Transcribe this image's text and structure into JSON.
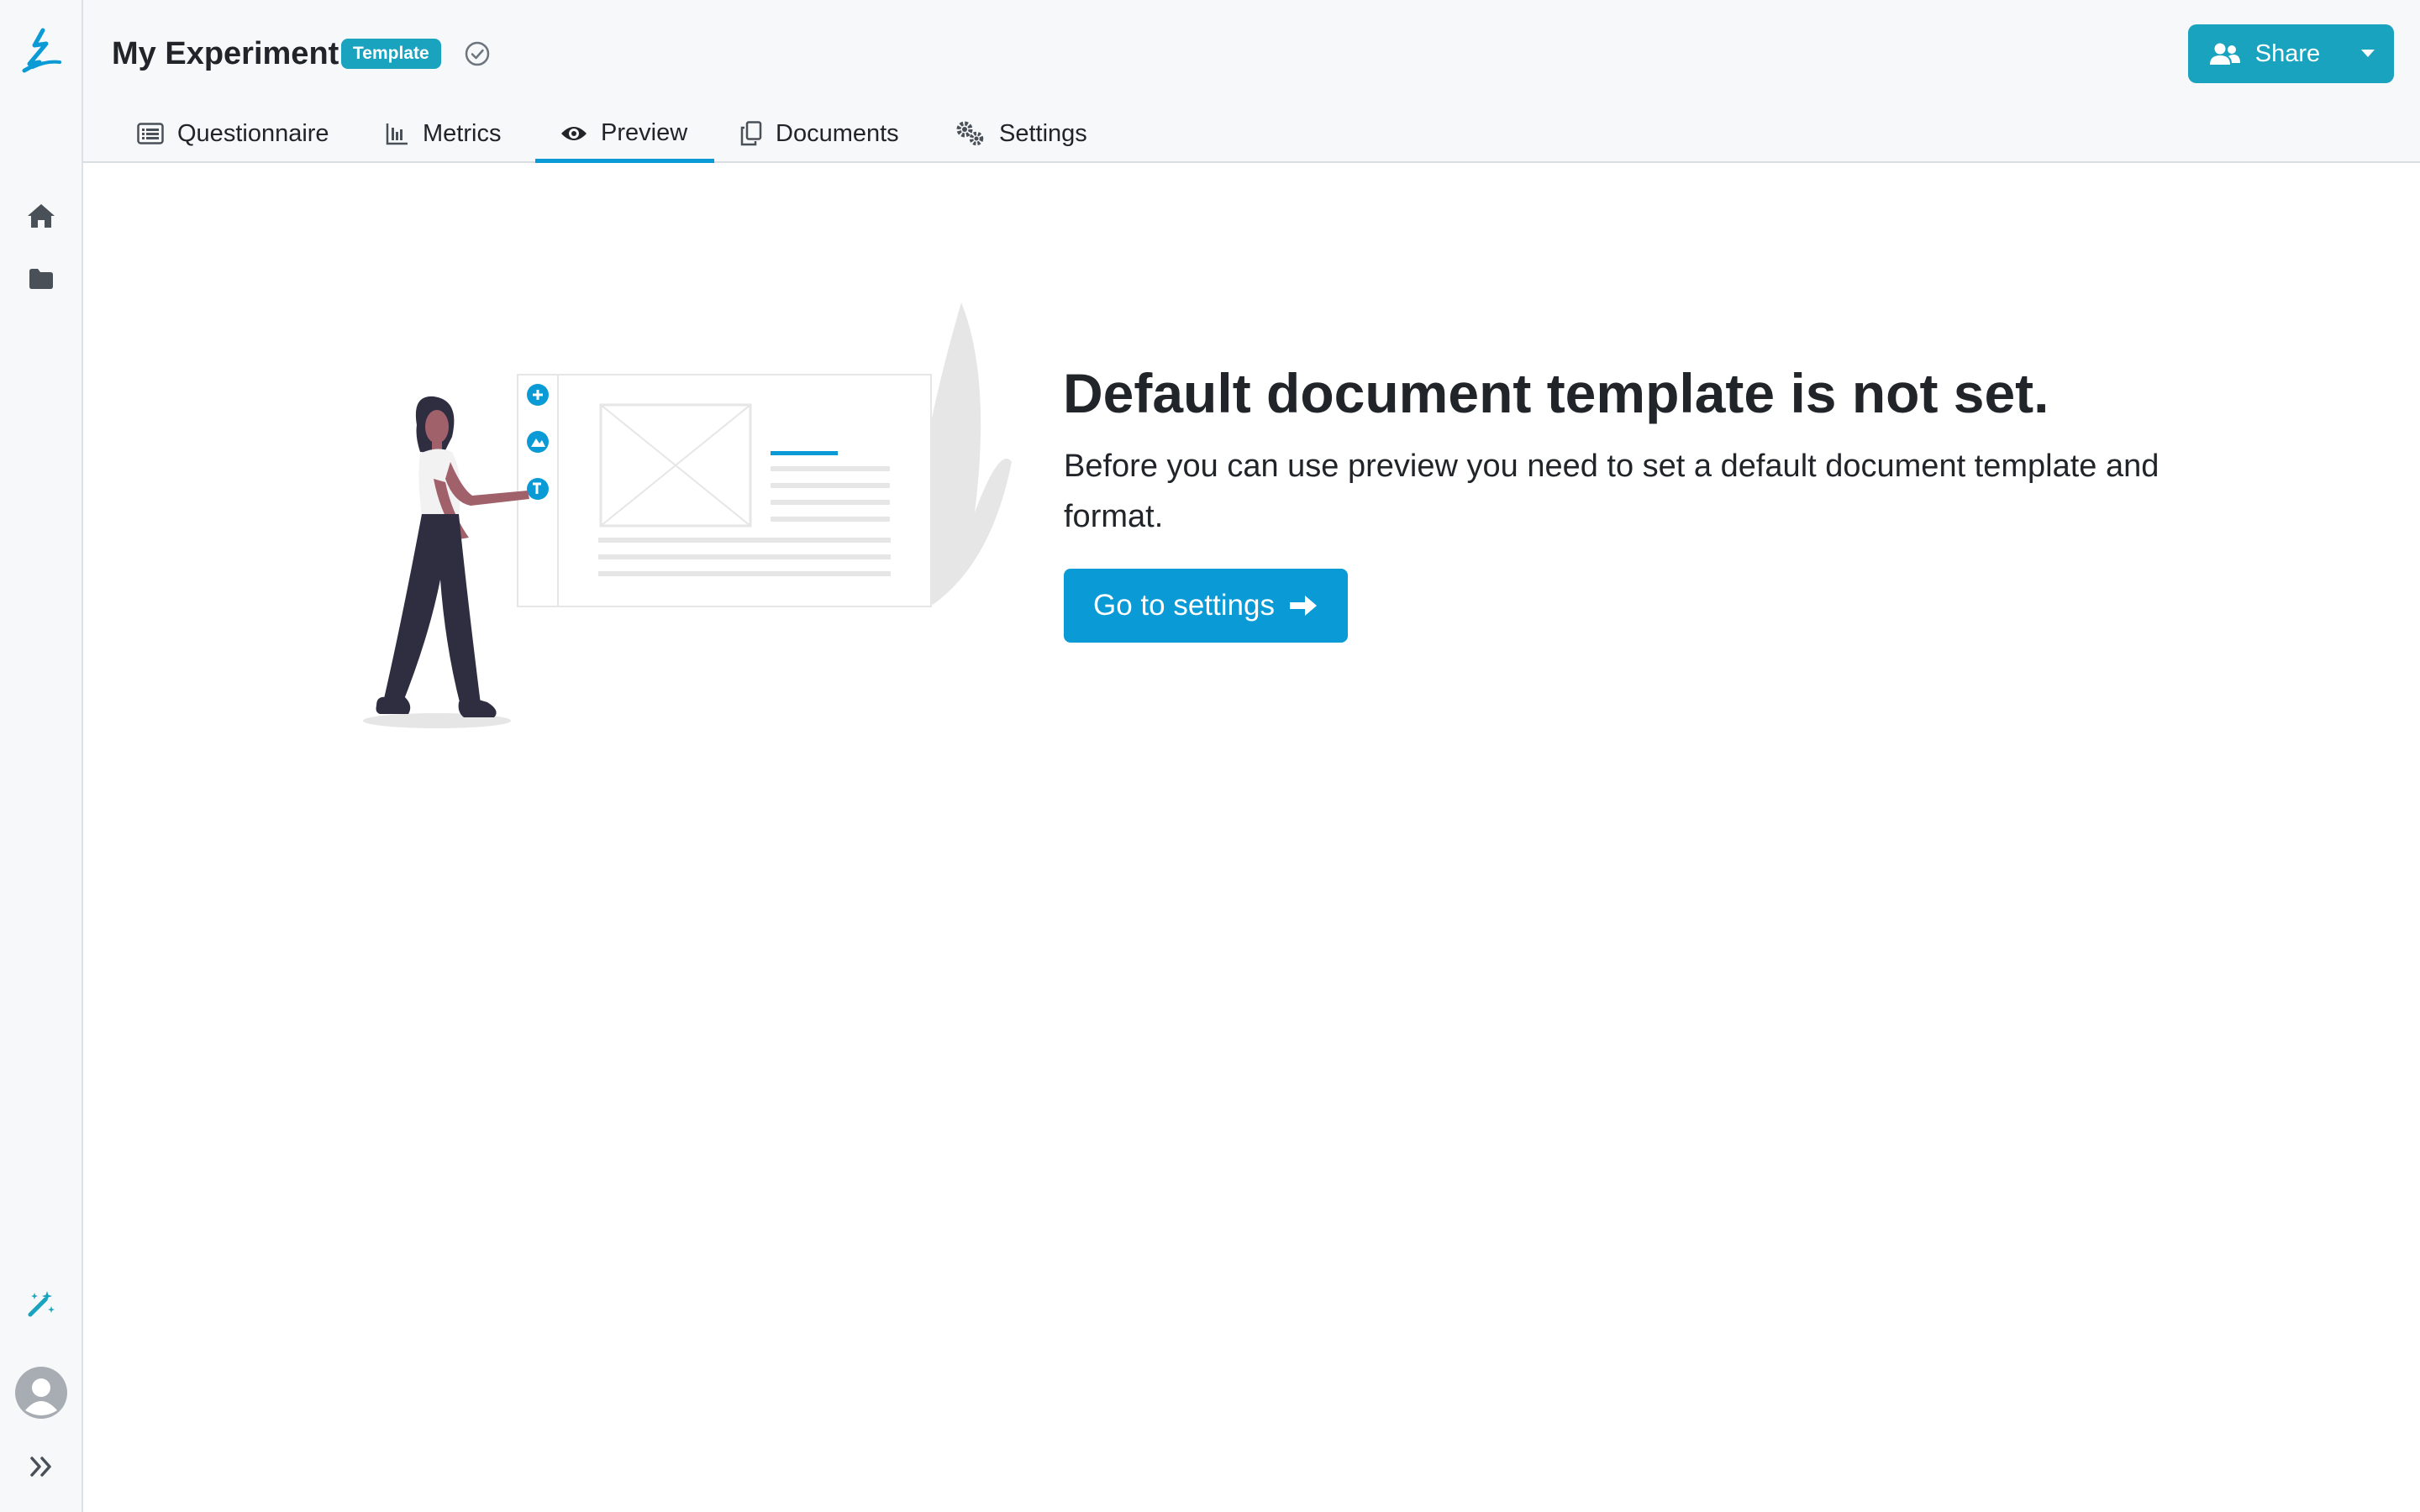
{
  "header": {
    "title": "My Experiment",
    "badge": "Template",
    "share_label": "Share"
  },
  "tabs": [
    {
      "label": "Questionnaire",
      "icon": "list-alt-icon",
      "active": false
    },
    {
      "label": "Metrics",
      "icon": "chart-icon",
      "active": false
    },
    {
      "label": "Preview",
      "icon": "eye-icon",
      "active": true
    },
    {
      "label": "Documents",
      "icon": "copy-icon",
      "active": false
    },
    {
      "label": "Settings",
      "icon": "cogs-icon",
      "active": false
    }
  ],
  "rail": {
    "icons": [
      "logo-icon",
      "home-icon",
      "folder-icon",
      "magic-wand-icon",
      "avatar",
      "expand-icon"
    ]
  },
  "main": {
    "heading": "Default document template is not set.",
    "message": "Before you can use preview you need to set a default document template and format.",
    "button_label": "Go to settings"
  },
  "colors": {
    "accent": "#1aa3bf",
    "primary": "#0a9ad6",
    "sidebar_bg": "#f6f8fa",
    "text": "#212529"
  }
}
